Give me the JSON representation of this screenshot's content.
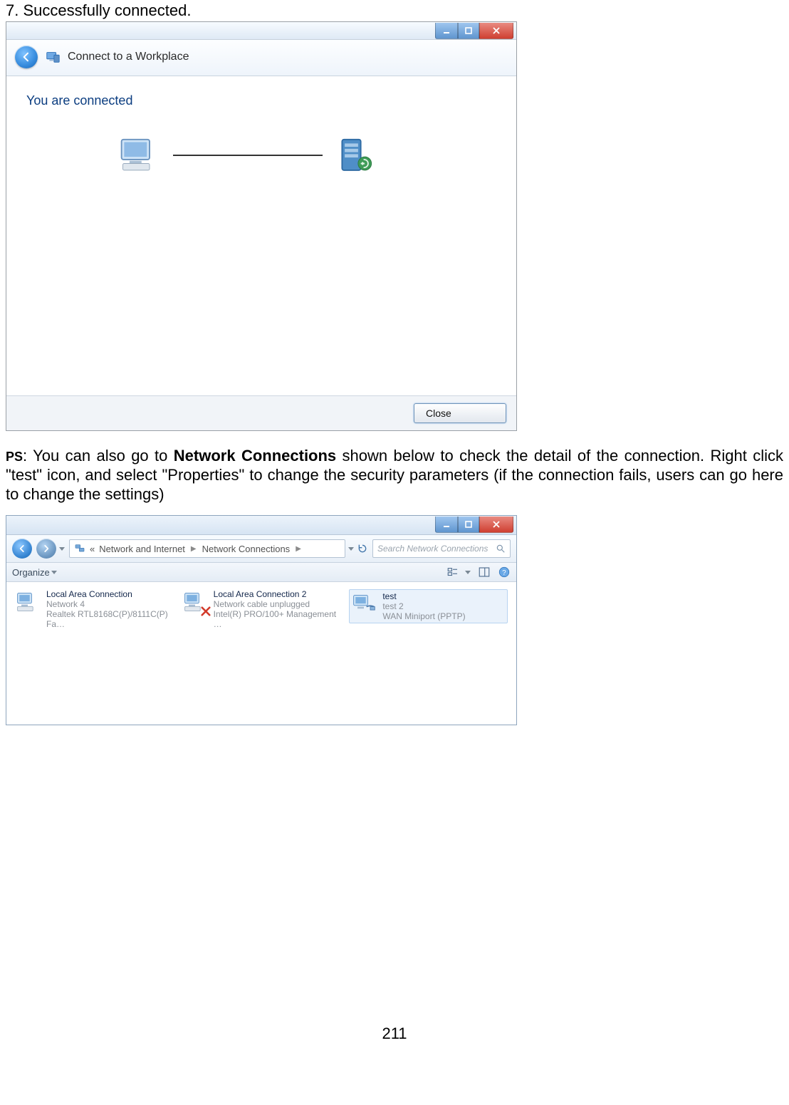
{
  "step_line": "7. Successfully connected.",
  "wizard": {
    "title": "Connect to a Workplace",
    "heading": "You are connected",
    "close_btn": "Close"
  },
  "ps": {
    "label": "PS",
    "text_before_bold": ": You can also go to ",
    "bold": "Network Connections",
    "text_after_bold": " shown below to check the detail of the connection. Right click \"test\" icon, and select \"Properties\" to change the security parameters (if the connection fails, users can go here to change the settings)"
  },
  "explorer": {
    "breadcrumb": {
      "chevrons": "«",
      "seg1": "Network and Internet",
      "seg2": "Network Connections"
    },
    "search_placeholder": "Search Network Connections",
    "organize_label": "Organize",
    "items": [
      {
        "title": "Local Area Connection",
        "line2": "Network 4",
        "line3": "Realtek RTL8168C(P)/8111C(P) Fa…",
        "state": "connected"
      },
      {
        "title": "Local Area Connection 2",
        "line2": "Network cable unplugged",
        "line3": "Intel(R) PRO/100+ Management …",
        "state": "unplugged"
      },
      {
        "title": "test",
        "line2": "test 2",
        "line3": "WAN Miniport (PPTP)",
        "state": "vpn"
      }
    ]
  },
  "page_number": "211"
}
